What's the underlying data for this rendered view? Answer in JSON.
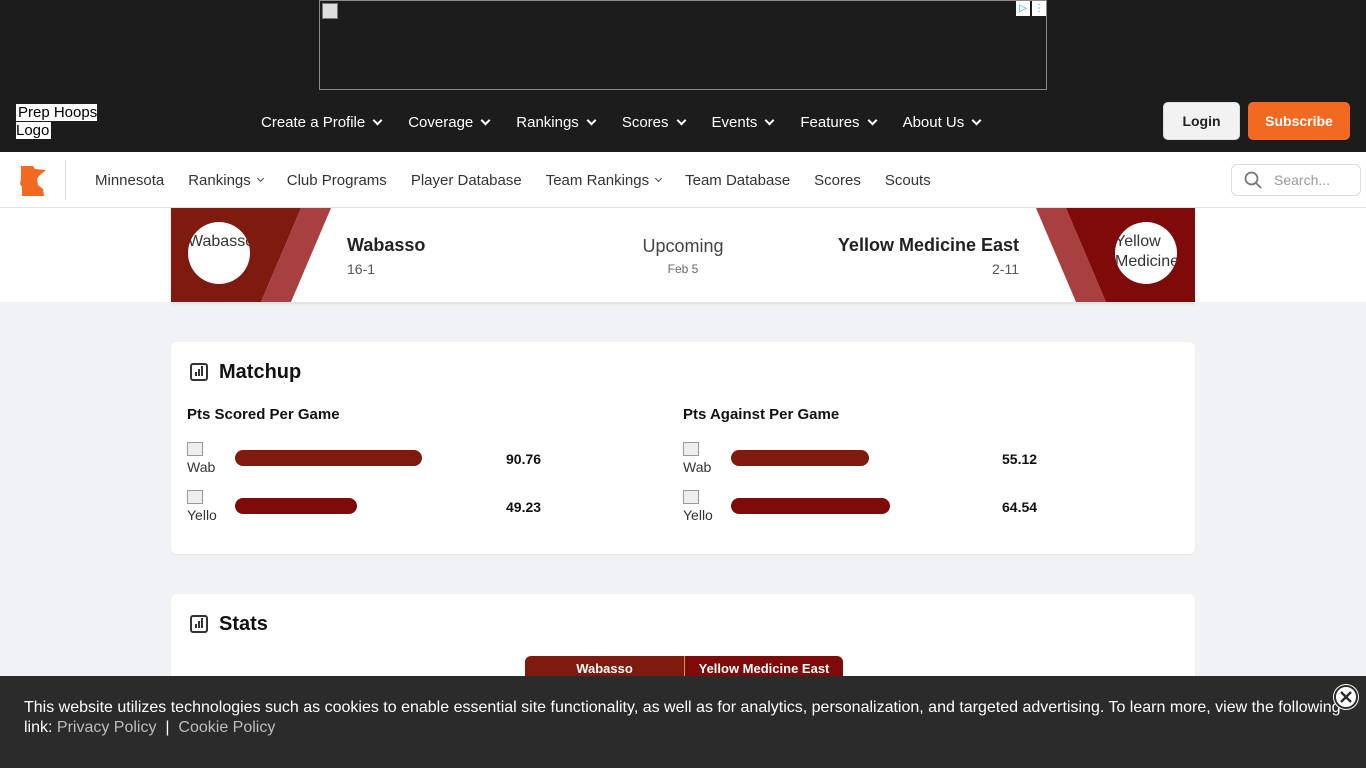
{
  "header": {
    "logo_alt": "Prep Hoops Logo",
    "nav": [
      {
        "label": "Create a Profile"
      },
      {
        "label": "Coverage"
      },
      {
        "label": "Rankings"
      },
      {
        "label": "Scores"
      },
      {
        "label": "Events"
      },
      {
        "label": "Features"
      },
      {
        "label": "About Us"
      }
    ],
    "login_label": "Login",
    "subscribe_label": "Subscribe"
  },
  "subnav": {
    "links": [
      {
        "label": "Minnesota",
        "dropdown": false
      },
      {
        "label": "Rankings",
        "dropdown": true
      },
      {
        "label": "Club Programs",
        "dropdown": false
      },
      {
        "label": "Player Database",
        "dropdown": false
      },
      {
        "label": "Team Rankings",
        "dropdown": true
      },
      {
        "label": "Team Database",
        "dropdown": false
      },
      {
        "label": "Scores",
        "dropdown": false
      },
      {
        "label": "Scouts",
        "dropdown": false
      }
    ],
    "search_placeholder": "Search..."
  },
  "game": {
    "home": {
      "name": "Wabasso",
      "record": "16-1",
      "logo_alt": "Wabasso",
      "color": "#7e1b0e"
    },
    "away": {
      "name": "Yellow Medicine East",
      "record": "2-11",
      "logo_alt": "Yellow Medicine",
      "color": "#7e0a0a"
    },
    "status": "Upcoming",
    "date": "Feb 5"
  },
  "matchup": {
    "title": "Matchup",
    "scored": {
      "label": "Pts Scored Per Game",
      "rows": [
        {
          "team_alt": "Wab",
          "value": "90.76",
          "fill": 0.83
        },
        {
          "team_alt": "Yello",
          "value": "49.23",
          "fill": 0.45
        }
      ]
    },
    "against": {
      "label": "Pts Against Per Game",
      "rows": [
        {
          "team_alt": "Wab",
          "value": "55.12",
          "fill": 0.51
        },
        {
          "team_alt": "Yello",
          "value": "64.54",
          "fill": 0.59
        }
      ]
    }
  },
  "stats": {
    "title": "Stats",
    "tabs": [
      "Wabasso",
      "Yellow Medicine East"
    ]
  },
  "cookie": {
    "text": "This website utilizes technologies such as cookies to enable essential site functionality, as well as for analytics, personalization, and targeted advertising. To learn more, view the following link:",
    "privacy_label": "Privacy Policy",
    "separator": "|",
    "cookie_label": "Cookie Policy"
  },
  "colors": {
    "accent": "#f26a22",
    "bar_home": "#7e1b0e",
    "bar_away": "#7e0a0a"
  }
}
